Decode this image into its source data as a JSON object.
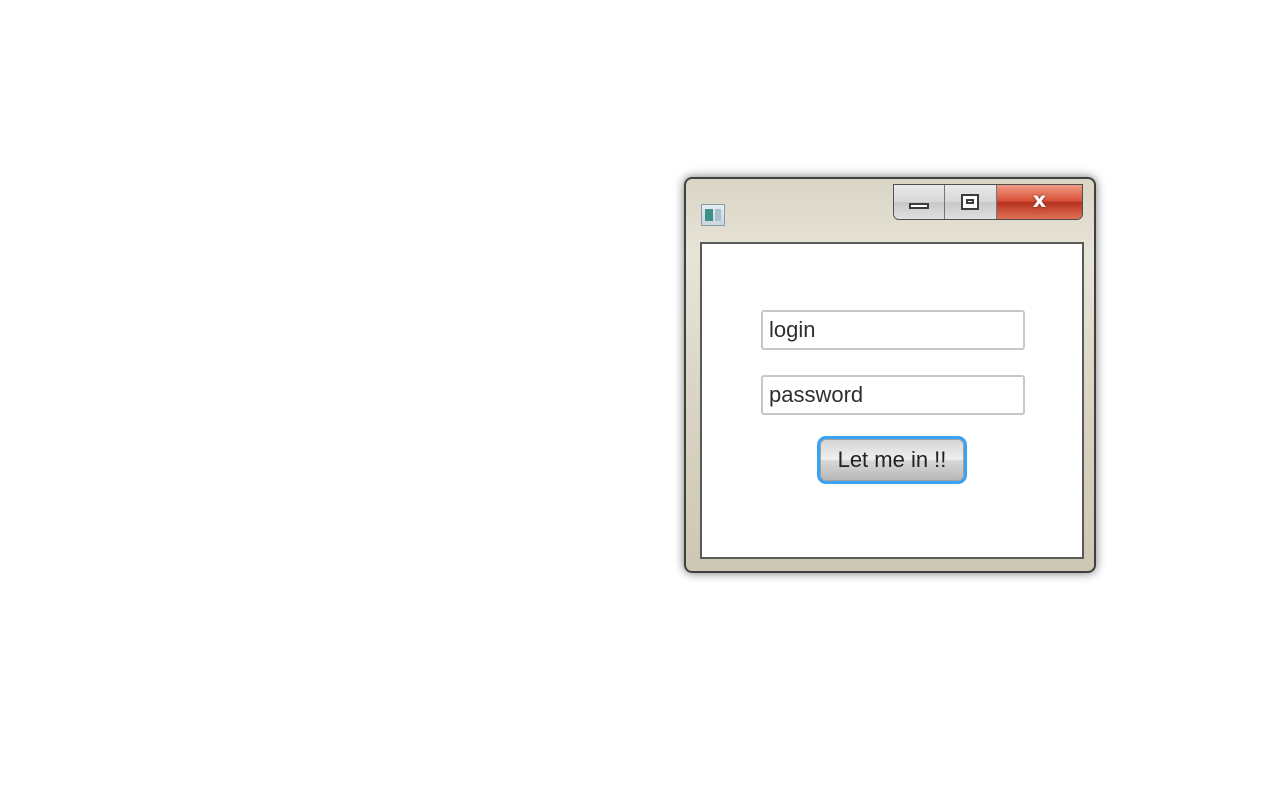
{
  "window": {
    "title_icon": "application-icon",
    "caption_buttons": {
      "minimize_icon": "minimize-icon",
      "maximize_icon": "maximize-icon",
      "close_icon": "close-icon",
      "close_label": "x"
    }
  },
  "form": {
    "login_placeholder": "login",
    "password_placeholder": "password",
    "submit_label": "Let me in !!"
  },
  "colors": {
    "focus_ring": "#39a2f2",
    "close_button": "#c9442d"
  }
}
